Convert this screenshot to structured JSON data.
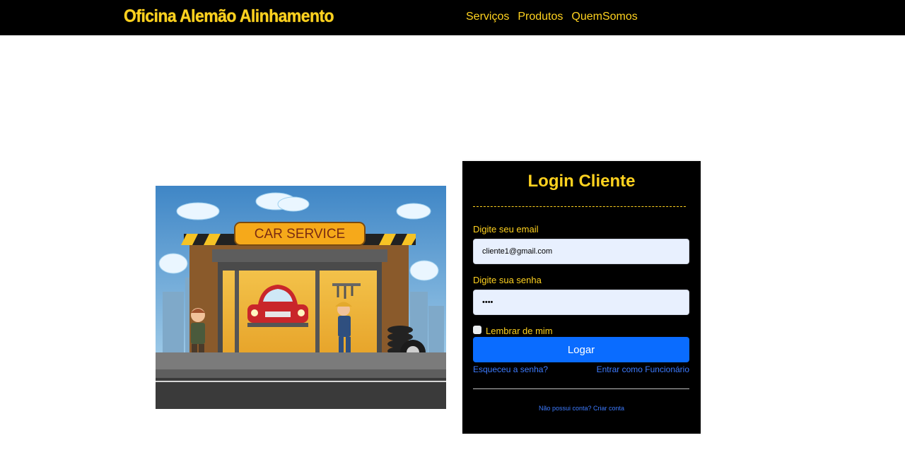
{
  "header": {
    "brand": "Oficina Alemão Alinhamento",
    "nav": [
      "Serviços",
      "Produtos",
      "QuemSomos"
    ]
  },
  "hero": {
    "sign_text": "CAR SERVICE"
  },
  "login": {
    "title": "Login Cliente",
    "email_label": "Digite seu email",
    "email_value": "cliente1@gmail.com",
    "password_label": "Digite sua senha",
    "password_value": "••••",
    "remember_label": "Lembrar de mim",
    "submit_label": "Logar",
    "forgot_link": "Esqueceu a senha?",
    "employee_link": "Entrar como Funcionário",
    "signup_text": "Não possui conta? Criar conta"
  },
  "colors": {
    "brand_yellow": "#FFD21F",
    "header_bg": "#000000",
    "button_blue": "#0A6CFF",
    "link_blue": "#3D7BFF",
    "input_bg": "#E8F0FE"
  }
}
